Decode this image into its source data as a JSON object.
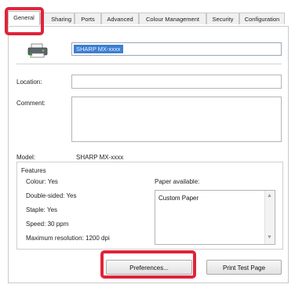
{
  "tabs": [
    {
      "label": "General",
      "active": true
    },
    {
      "label": "Sharing",
      "active": false
    },
    {
      "label": "Ports",
      "active": false
    },
    {
      "label": "Advanced",
      "active": false
    },
    {
      "label": "Colour Management",
      "active": false
    },
    {
      "label": "Security",
      "active": false
    },
    {
      "label": "Configuration",
      "active": false
    }
  ],
  "printer": {
    "icon": "printer-icon",
    "name_value": "SHARP MX-xxxx"
  },
  "location": {
    "label": "Location:",
    "value": ""
  },
  "comment": {
    "label": "Comment:",
    "value": ""
  },
  "model": {
    "label": "Model:",
    "value": "SHARP MX-xxxx"
  },
  "features": {
    "title": "Features",
    "items": [
      "Colour: Yes",
      "Double-sided: Yes",
      "Staple: Yes",
      "Speed: 30 ppm",
      "Maximum resolution: 1200 dpi"
    ],
    "paper_label": "Paper available:",
    "paper_items": [
      "Custom Paper"
    ]
  },
  "buttons": {
    "preferences": "Preferences...",
    "print_test_page": "Print Test Page"
  },
  "colors": {
    "highlight": "#e0233a",
    "selection": "#3c7fd1"
  }
}
